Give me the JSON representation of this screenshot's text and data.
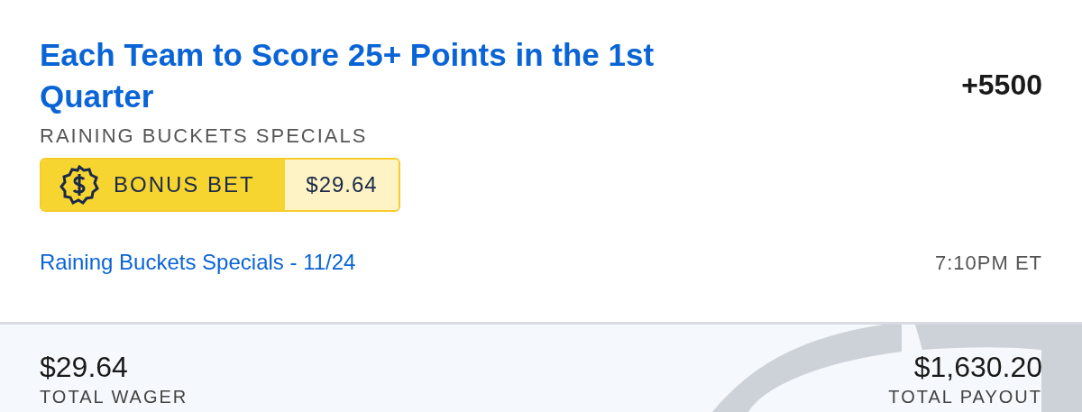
{
  "bet": {
    "title": "Each Team to Score 25+ Points in the 1st Quarter",
    "odds": "+5500",
    "market": "RAINING BUCKETS SPECIALS",
    "bonus": {
      "label": "BONUS BET",
      "amount": "$29.64"
    },
    "event": "Raining Buckets Specials - 11/24",
    "time": "7:10PM ET"
  },
  "summary": [
    {
      "value": "$29.64",
      "label": "TOTAL WAGER"
    },
    {
      "value": "$1,630.20",
      "label": "TOTAL PAYOUT"
    }
  ]
}
